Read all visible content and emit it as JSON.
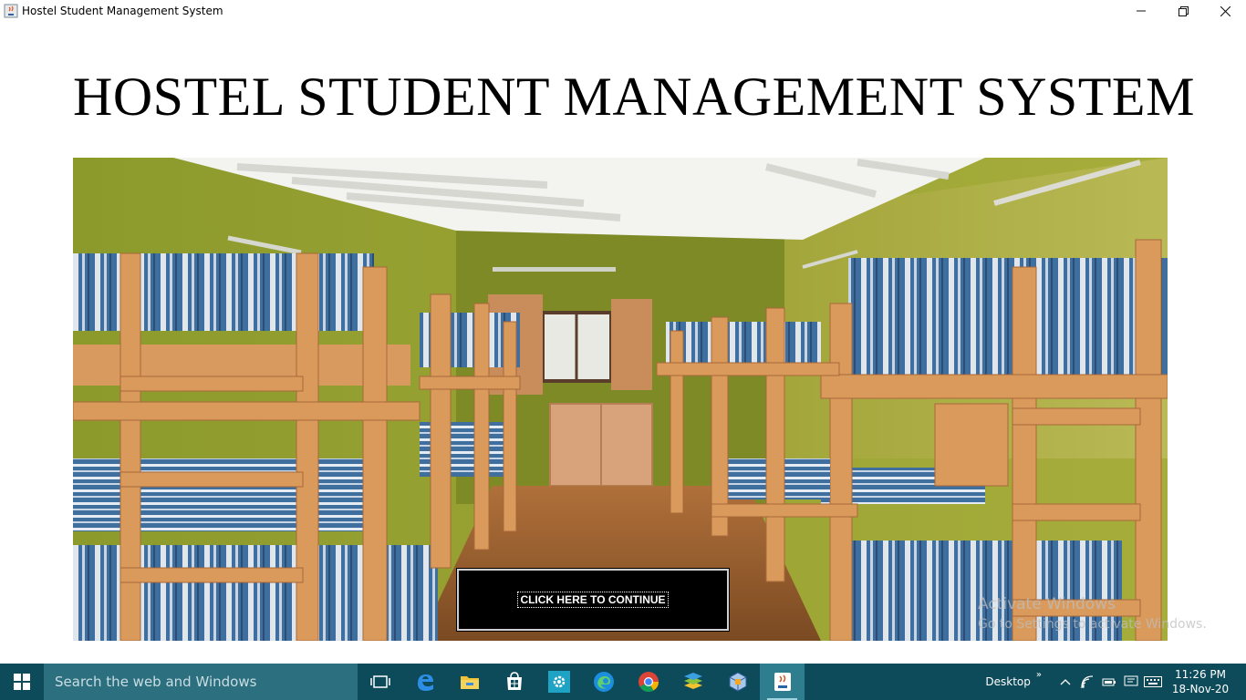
{
  "window": {
    "title": "Hostel Student Management System",
    "controls": [
      "minimize-icon",
      "restore-icon",
      "close-icon"
    ]
  },
  "main": {
    "heading": "HOSTEL STUDENT MANAGEMENT SYSTEM",
    "continue_label": "CLICK HERE TO CONTINUE"
  },
  "watermark": {
    "line1": "Activate Windows",
    "line2": "Go to Settings to activate Windows."
  },
  "taskbar": {
    "search_placeholder": "Search the web and Windows",
    "apps": [
      "task-view-icon",
      "edge-legacy-icon",
      "file-explorer-icon",
      "store-icon",
      "settings-icon",
      "edge-icon",
      "chrome-icon",
      "bluestacks-icon",
      "virtualbox-icon",
      "java-icon"
    ],
    "desktop_label": "Desktop",
    "chevron": "»",
    "time": "11:26 PM",
    "date": "18-Nov-20"
  },
  "colors": {
    "taskbar": "#0d4b5a",
    "search": "#2c6f7f",
    "button": "#000000"
  }
}
